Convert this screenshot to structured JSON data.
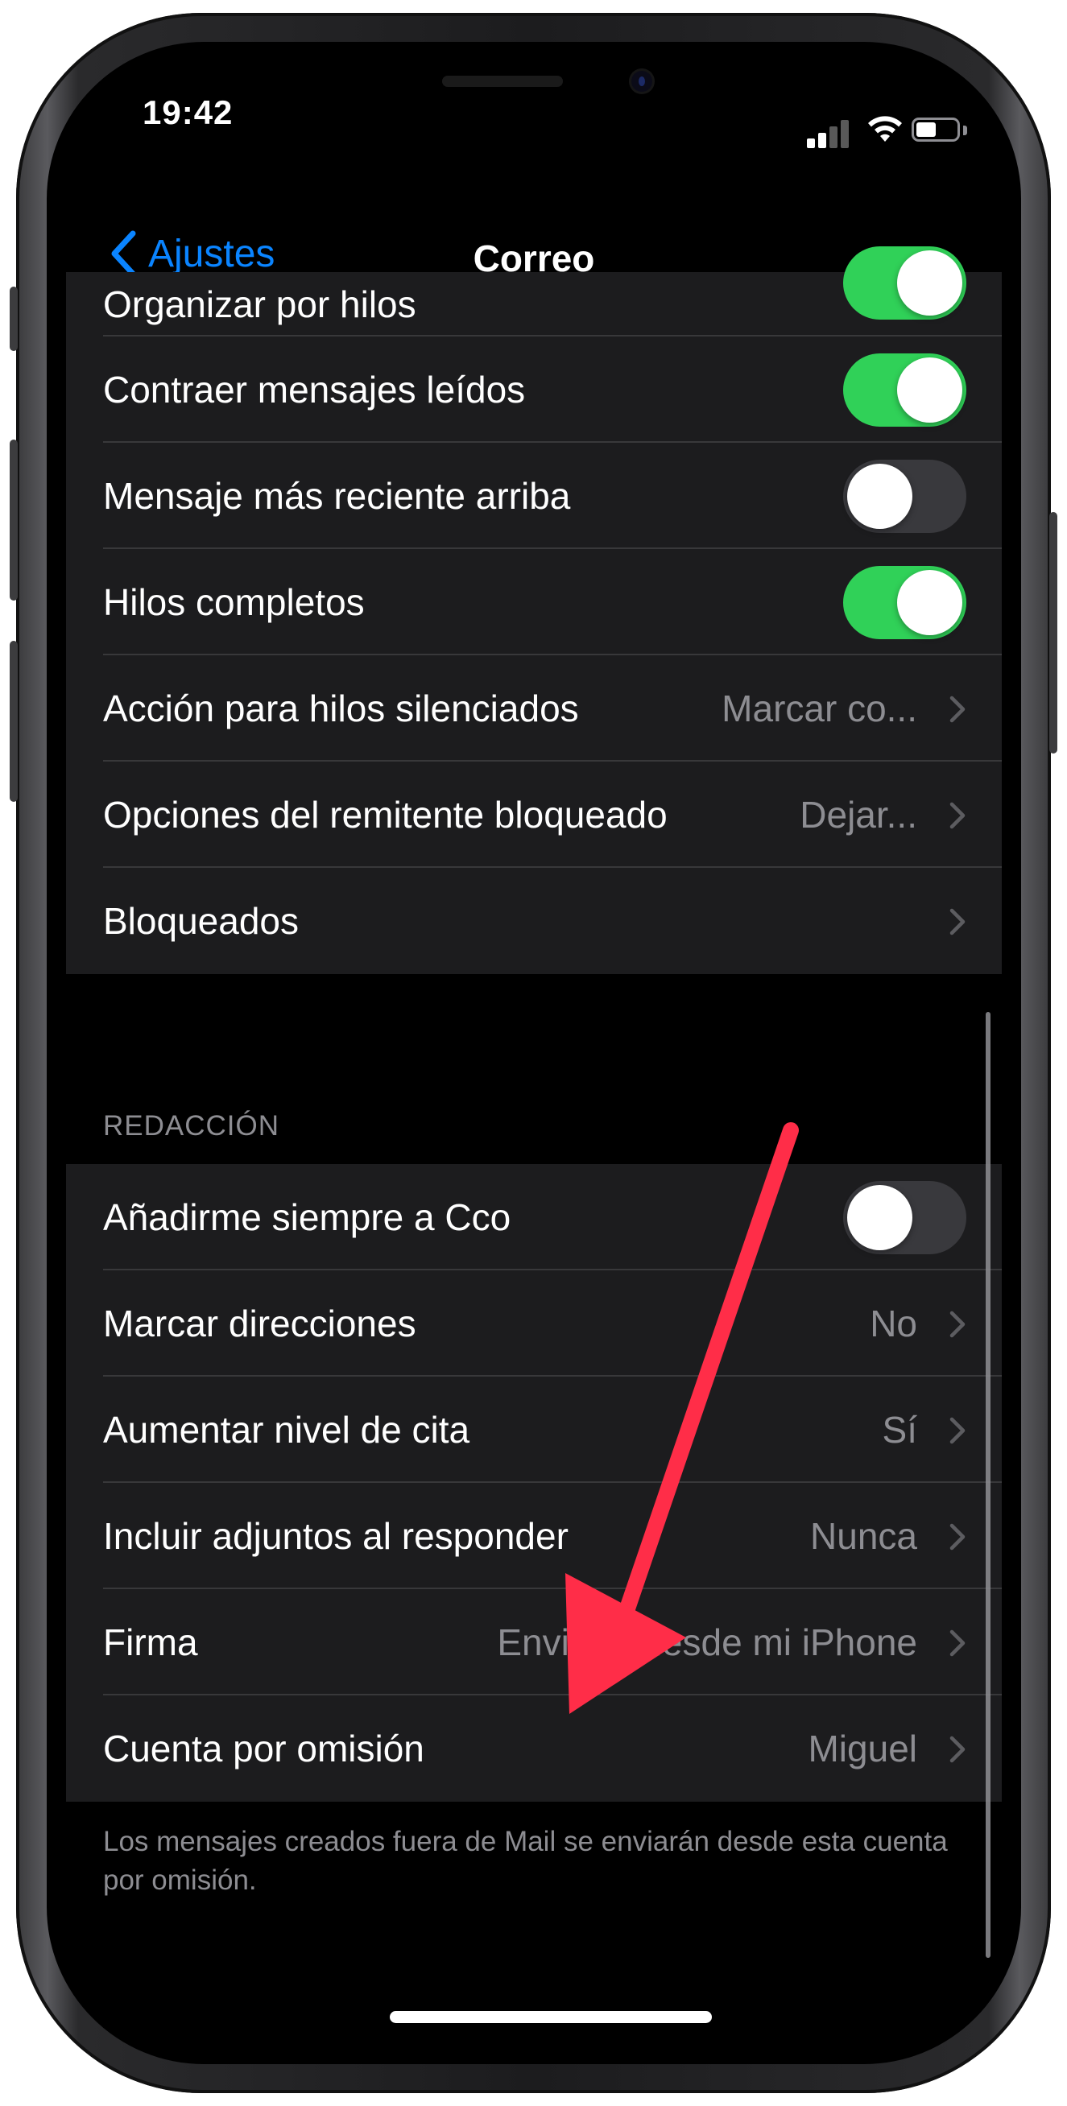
{
  "status": {
    "time": "19:42"
  },
  "nav": {
    "back_label": "Ajustes",
    "title": "Correo"
  },
  "threads_group": [
    {
      "label": "Organizar por hilos",
      "type": "toggle",
      "on": true
    },
    {
      "label": "Contraer mensajes leídos",
      "type": "toggle",
      "on": true
    },
    {
      "label": "Mensaje más reciente arriba",
      "type": "toggle",
      "on": false
    },
    {
      "label": "Hilos completos",
      "type": "toggle",
      "on": true
    },
    {
      "label": "Acción para hilos silenciados",
      "type": "link",
      "value": "Marcar co..."
    },
    {
      "label": "Opciones del remitente bloqueado",
      "type": "link",
      "value": "Dejar..."
    },
    {
      "label": "Bloqueados",
      "type": "link",
      "value": ""
    }
  ],
  "composing": {
    "header": "REDACCIÓN",
    "rows": [
      {
        "label": "Añadirme siempre a Cco",
        "type": "toggle",
        "on": false
      },
      {
        "label": "Marcar direcciones",
        "type": "link",
        "value": "No"
      },
      {
        "label": "Aumentar nivel de cita",
        "type": "link",
        "value": "Sí"
      },
      {
        "label": "Incluir adjuntos al responder",
        "type": "link",
        "value": "Nunca"
      },
      {
        "label": "Firma",
        "type": "link",
        "value": "Enviado desde mi iPhone"
      },
      {
        "label": "Cuenta por omisión",
        "type": "link",
        "value": "Miguel"
      }
    ],
    "footer": "Los mensajes creados fuera de Mail se enviarán desde esta cuenta por omisión."
  },
  "colors": {
    "accent": "#0a84ff",
    "toggle_on": "#30d158",
    "toggle_off": "#39393d",
    "cell_background": "#1c1c1e",
    "secondary_text": "#8d8d92",
    "annotation_arrow": "#ff2d48"
  },
  "icons": {
    "back": "chevron-left-icon",
    "row_disclosure": "chevron-right-icon",
    "cellular": "cellular-signal-icon",
    "wifi": "wifi-icon",
    "battery": "battery-icon"
  }
}
